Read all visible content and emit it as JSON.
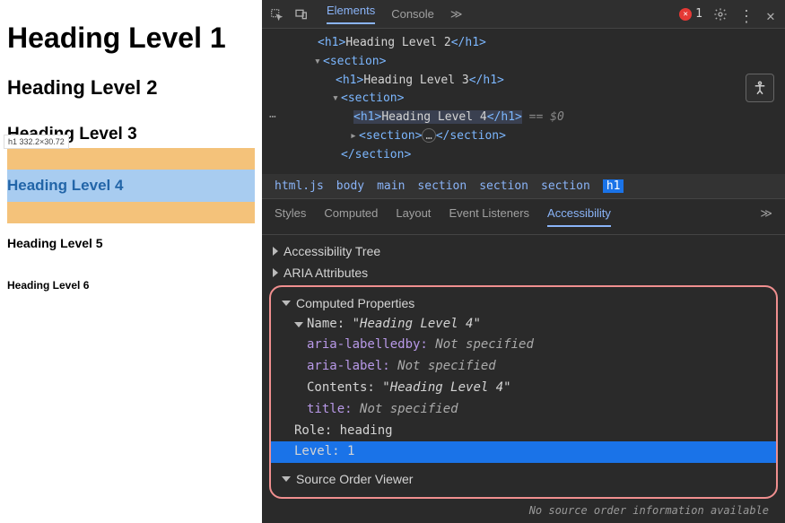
{
  "page": {
    "h1": "Heading Level 1",
    "h2": "Heading Level 2",
    "h3": "Heading Level 3",
    "h4": "Heading Level 4",
    "h5": "Heading Level 5",
    "h6": "Heading Level 6",
    "tooltip": "h1 332.2×30.72"
  },
  "toolbar": {
    "tabs": {
      "elements": "Elements",
      "console": "Console"
    },
    "errors": "1"
  },
  "dom": {
    "l1": {
      "open": "<h1>",
      "text": "Heading Level 2",
      "close": "</h1>"
    },
    "l2": {
      "open": "<section>"
    },
    "l3": {
      "open": "<h1>",
      "text": "Heading Level 3",
      "close": "</h1>"
    },
    "l4": {
      "open": "<section>"
    },
    "l5": {
      "open": "<h1>",
      "text": "Heading Level 4",
      "close": "</h1>",
      "suffix": " == $0"
    },
    "l6": {
      "open": "<section>",
      "mid": "…",
      "close": "</section>"
    },
    "l7": {
      "close": "</section>"
    }
  },
  "breadcrumbs": [
    "html.js",
    "body",
    "main",
    "section",
    "section",
    "section",
    "h1"
  ],
  "subtabs": {
    "styles": "Styles",
    "computed": "Computed",
    "layout": "Layout",
    "listeners": "Event Listeners",
    "accessibility": "Accessibility"
  },
  "panel": {
    "tree": "Accessibility Tree",
    "aria": "ARIA Attributes",
    "computed": "Computed Properties",
    "name": {
      "label": "Name:",
      "value": "\"Heading Level 4\""
    },
    "aria_labelledby": {
      "key": "aria-labelledby:",
      "val": "Not specified"
    },
    "aria_label": {
      "key": "aria-label:",
      "val": "Not specified"
    },
    "contents": {
      "key": "Contents:",
      "val": "\"Heading Level 4\""
    },
    "title": {
      "key": "title:",
      "val": "Not specified"
    },
    "role": {
      "key": "Role:",
      "val": "heading"
    },
    "level": {
      "key": "Level:",
      "val": "1"
    },
    "source_order": "Source Order Viewer",
    "footer": "No source order information available"
  }
}
